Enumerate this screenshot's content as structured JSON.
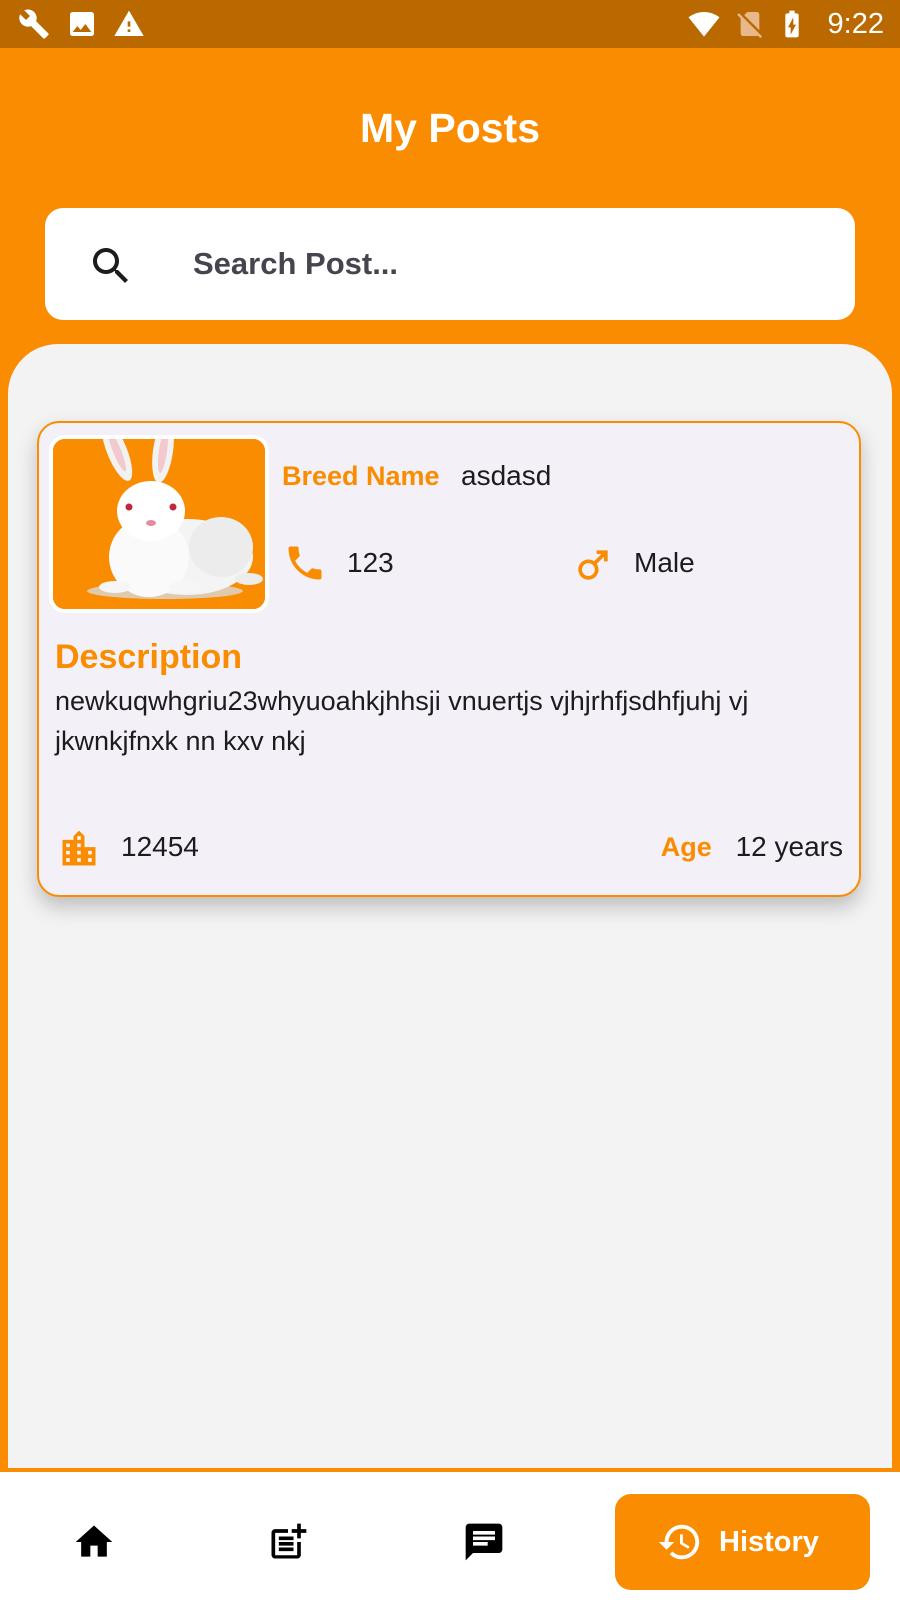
{
  "status_bar": {
    "time": "9:22",
    "left_icons": [
      "wrench-icon",
      "image-icon",
      "warning-icon"
    ],
    "right_icons": [
      "wifi-icon",
      "no-sim-icon",
      "battery-charging-icon"
    ]
  },
  "header": {
    "title": "My Posts"
  },
  "search": {
    "placeholder": "Search Post...",
    "value": ""
  },
  "post": {
    "image": "white-rabbit",
    "breed_label": "Breed Name",
    "breed_value": "asdasd",
    "phone": "123",
    "gender": "Male",
    "description_heading": "Description",
    "description": "newkuqwhgriu23whyuoahkjhhsji vnuertjs vjhjrhfjsdhfjuhj vj jkwnkjfnxk nn kxv nkj",
    "city": "12454",
    "age_label": "Age",
    "age_value": "12 years"
  },
  "bottom_nav": {
    "items": [
      {
        "icon": "home-icon",
        "label": ""
      },
      {
        "icon": "post-add-icon",
        "label": ""
      },
      {
        "icon": "chat-icon",
        "label": ""
      },
      {
        "icon": "history-icon",
        "label": "History"
      }
    ],
    "active": "History"
  },
  "colors": {
    "primary": "#F98C00",
    "status_bar": "#BA6900",
    "card_bg": "#F4F0F7",
    "panel_bg": "#F3F3F3"
  }
}
